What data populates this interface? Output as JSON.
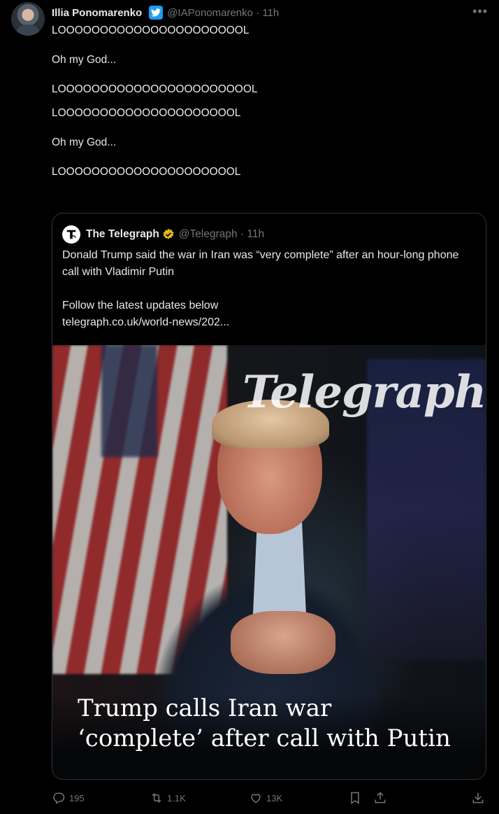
{
  "tweet": {
    "author_name": "Illia Ponomarenko",
    "author_handle_time": "@IAPonomarenko · 11h",
    "lines": [
      "LOOOOOOOOOOOOOOOOOOOOOOL",
      "",
      "Oh my God...",
      "",
      "LOOOOOOOOOOOOOOOOOOOOOOOL",
      "LOOOOOOOOOOOOOOOOOOOOOL",
      "",
      "Oh my God...",
      "",
      "LOOOOOOOOOOOOOOOOOOOOOL"
    ]
  },
  "quote": {
    "author_name": "The Telegraph",
    "author_handle_time": "@Telegraph · 11h",
    "text_line1": " Donald Trump said the war in Iran was “very complete” after an hour-long phone call with Vladimir Putin",
    "text_line2": "Follow the latest updates below",
    "text_link": "telegraph.co.uk/world-news/202...",
    "image": {
      "watermark": "Telegraph",
      "headline_line1": "Trump calls Iran war",
      "headline_line2": "‘complete’ after call with Putin"
    }
  },
  "actions": {
    "replies": "195",
    "retweets": "1.1K",
    "likes": "13K"
  },
  "colors": {
    "background": "#000000",
    "text": "#e7e9ea",
    "muted": "#71767b",
    "twitter_blue": "#1d9bf0",
    "verified_gold": "#e2b719"
  }
}
